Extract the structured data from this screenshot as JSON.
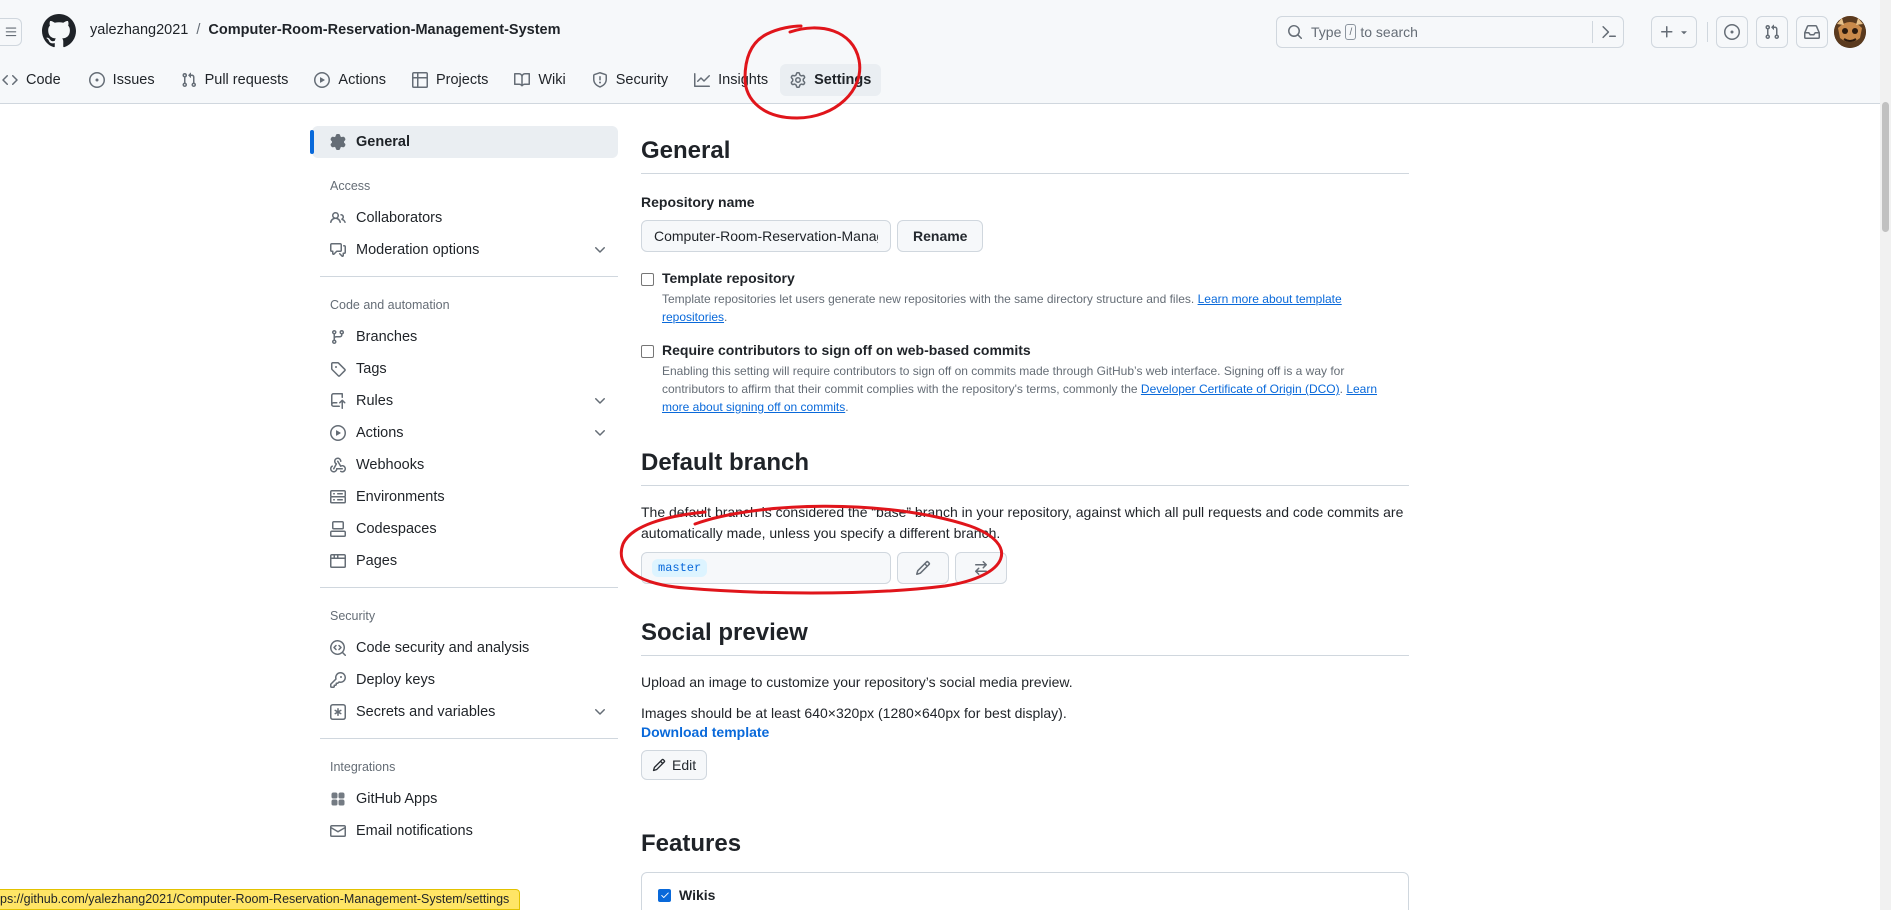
{
  "header": {
    "owner": "yalezhang2021",
    "separator": "/",
    "repo": "Computer-Room-Reservation-Management-System",
    "search_prefix": "Type",
    "search_key": "/",
    "search_suffix": "to search"
  },
  "tabs": [
    {
      "label": "Code",
      "icon": "code-icon"
    },
    {
      "label": "Issues",
      "icon": "issue-icon"
    },
    {
      "label": "Pull requests",
      "icon": "pull-request-icon"
    },
    {
      "label": "Actions",
      "icon": "play-icon"
    },
    {
      "label": "Projects",
      "icon": "table-icon"
    },
    {
      "label": "Wiki",
      "icon": "book-icon"
    },
    {
      "label": "Security",
      "icon": "shield-icon"
    },
    {
      "label": "Insights",
      "icon": "graph-icon"
    },
    {
      "label": "Settings",
      "icon": "gear-icon",
      "selected": true
    }
  ],
  "sidebar": {
    "general": "General",
    "groups": {
      "access": "Access",
      "code_automation": "Code and automation",
      "security": "Security",
      "integrations": "Integrations"
    },
    "access_items": [
      "Collaborators",
      "Moderation options"
    ],
    "code_items": [
      "Branches",
      "Tags",
      "Rules",
      "Actions",
      "Webhooks",
      "Environments",
      "Codespaces",
      "Pages"
    ],
    "security_items": [
      "Code security and analysis",
      "Deploy keys",
      "Secrets and variables"
    ],
    "integration_items": [
      "GitHub Apps",
      "Email notifications"
    ]
  },
  "main": {
    "general_title": "General",
    "repo_name_label": "Repository name",
    "repo_name_value": "Computer-Room-Reservation-Management-System",
    "rename_button": "Rename",
    "template": {
      "title": "Template repository",
      "desc": "Template repositories let users generate new repositories with the same directory structure and files. ",
      "link": "Learn more about template repositories",
      "end": "."
    },
    "signoff": {
      "title": "Require contributors to sign off on web-based commits",
      "desc": "Enabling this setting will require contributors to sign off on commits made through GitHub’s web interface. Signing off is a way for contributors to affirm that their commit complies with the repository's terms, commonly the ",
      "link1": "Developer Certificate of Origin (DCO)",
      "mid": ". ",
      "link2": "Learn more about signing off on commits",
      "end": "."
    },
    "default_branch_title": "Default branch",
    "default_branch_desc": "The default branch is considered the “base” branch in your repository, against which all pull requests and code commits are automatically made, unless you specify a different branch.",
    "branch_name": "master",
    "social_title": "Social preview",
    "social_desc": "Upload an image to customize your repository’s social media preview.",
    "social_size": "Images should be at least 640×320px (1280×640px for best display).",
    "download_template": "Download template",
    "edit_button": "Edit",
    "features_title": "Features",
    "wikis_label": "Wikis",
    "wikis_checked": true
  },
  "status_url": "ps://github.com/yalezhang2021/Computer-Room-Reservation-Management-System/settings",
  "colors": {
    "accent": "#0969da",
    "annotation": "#e0151b"
  }
}
